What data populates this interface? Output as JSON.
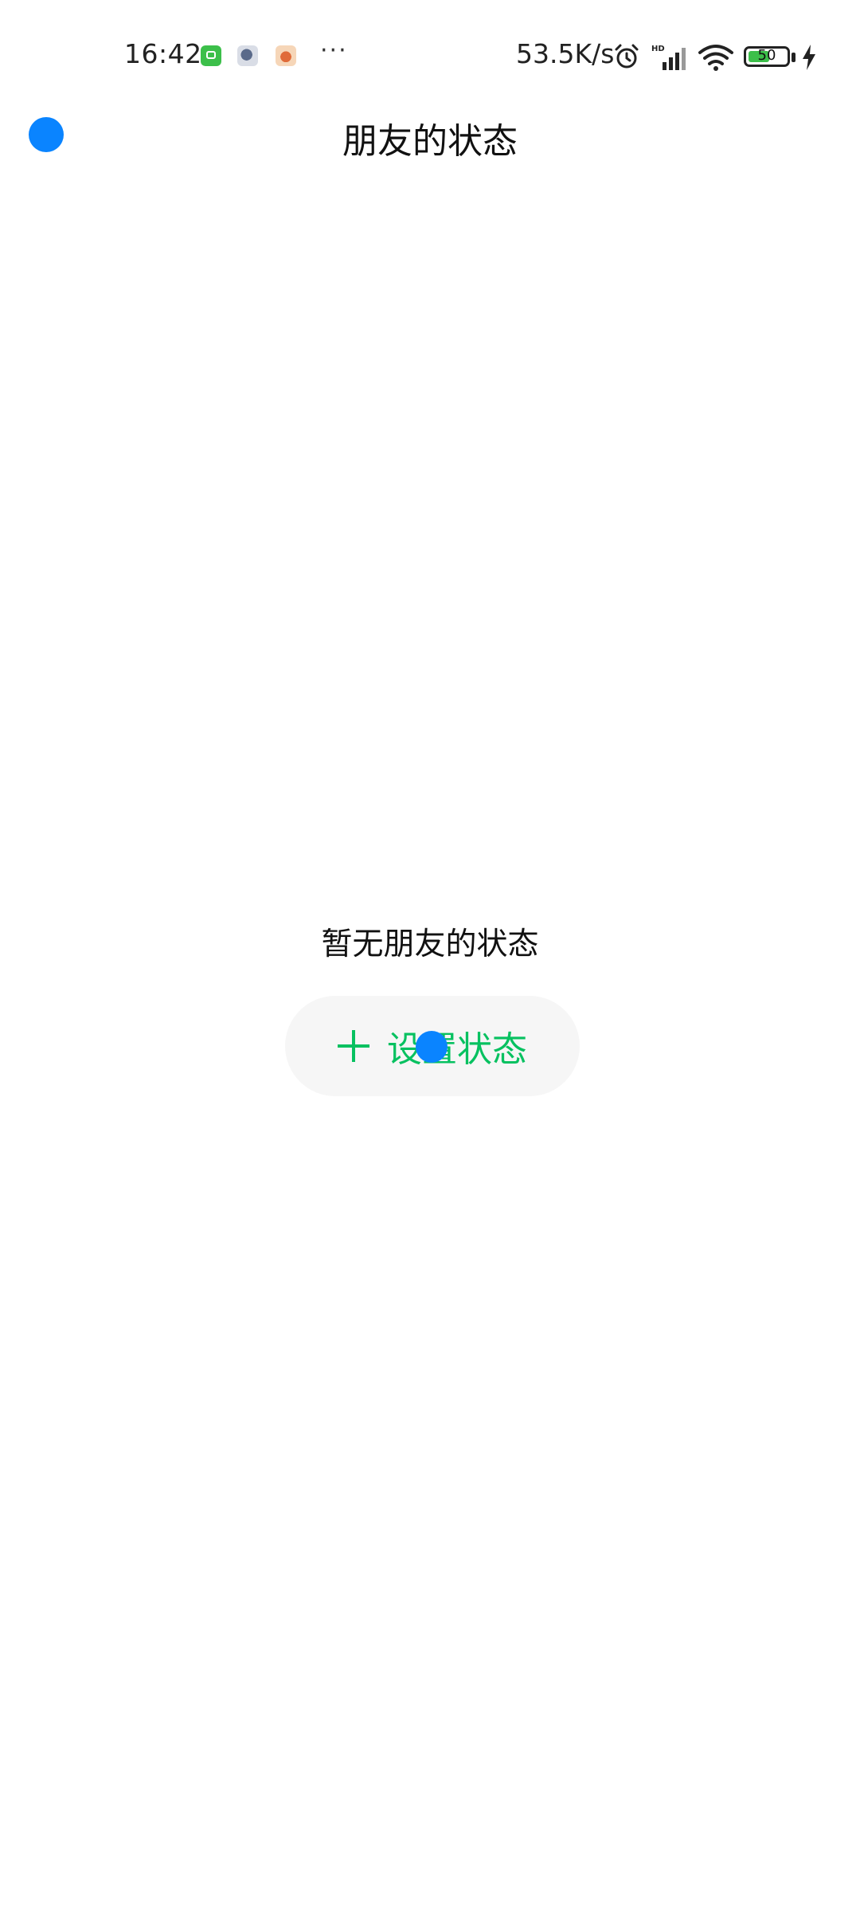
{
  "status_bar": {
    "time": "16:42",
    "more": "···",
    "net_speed": "53.5K/s",
    "battery_level": "50",
    "icons": [
      "green-app-icon",
      "notification-app-icon",
      "notification-app-icon-2",
      "alarm-icon",
      "hd-signal-icon",
      "wifi-icon",
      "battery-icon",
      "charging-bolt-icon"
    ]
  },
  "header": {
    "title": "朋友的状态",
    "back_icon": "back-icon"
  },
  "empty_state": {
    "message": "暂无朋友的状态",
    "button_label": "设置状态",
    "button_icon": "plus-icon"
  },
  "colors": {
    "accent_green": "#07c160",
    "touch_indicator": "#0a84ff",
    "button_bg": "#f6f6f6"
  }
}
